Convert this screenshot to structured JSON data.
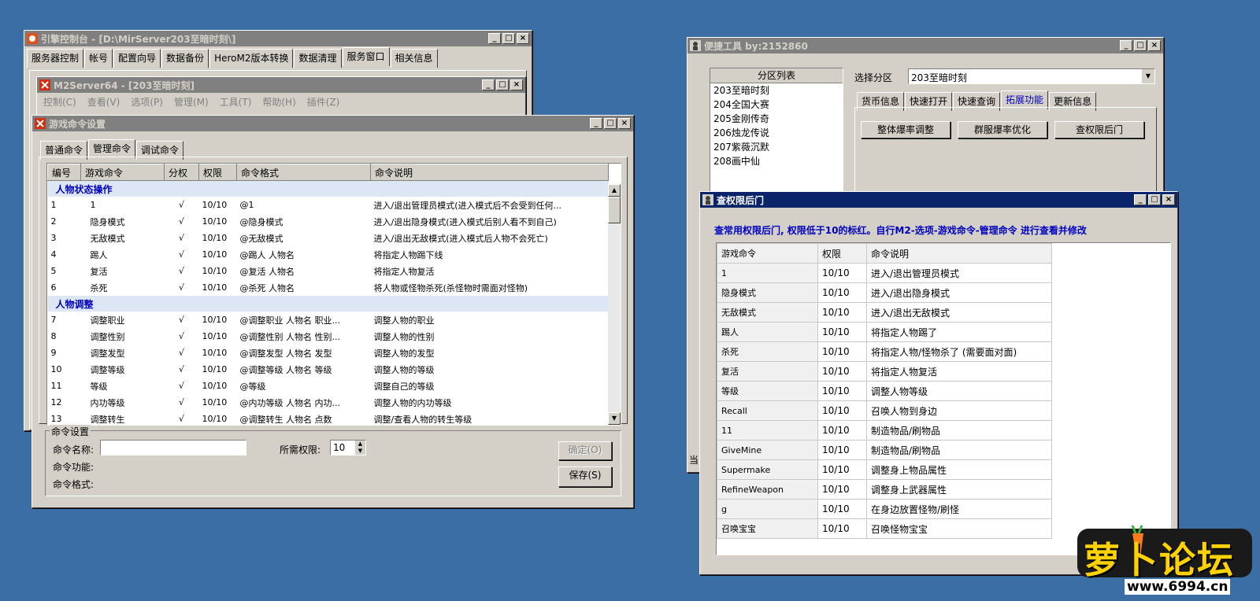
{
  "engine_console": {
    "title": "引擎控制台 - [D:\\MirServer203至暗时刻\\]",
    "tabs": [
      "服务器控制",
      "帐号",
      "配置向导",
      "数据备份",
      "HeroM2版本转换",
      "数据清理",
      "服务窗口",
      "相关信息"
    ],
    "selected_tab": "服务窗口"
  },
  "m2server": {
    "title": "M2Server64 - [203至暗时刻]",
    "menu": [
      "控制(C)",
      "查看(V)",
      "选项(P)",
      "管理(M)",
      "工具(T)",
      "帮助(H)",
      "插件(Z)"
    ]
  },
  "game_cmd": {
    "title": "游戏命令设置",
    "tabs": [
      "普通命令",
      "管理命令",
      "调试命令"
    ],
    "columns": [
      "编号",
      "游戏命令",
      "分权",
      "权限",
      "命令格式",
      "命令说明"
    ],
    "groups": [
      {
        "name": "人物状态操作",
        "rows": [
          [
            "1",
            "1",
            "√",
            "10/10",
            "@1",
            "进入/退出管理员模式(进入模式后不会受到任何..."
          ],
          [
            "2",
            "隐身模式",
            "√",
            "10/10",
            "@隐身模式",
            "进入/退出隐身模式(进入模式后别人看不到自己)"
          ],
          [
            "3",
            "无敌模式",
            "√",
            "10/10",
            "@无敌模式",
            "进入/退出无敌模式(进入模式后人物不会死亡)"
          ],
          [
            "4",
            "踢人",
            "√",
            "10/10",
            "@踢人 人物名",
            "将指定人物踢下线"
          ],
          [
            "5",
            "复活",
            "√",
            "10/10",
            "@复活 人物名",
            "将指定人物复活"
          ],
          [
            "6",
            "杀死",
            "√",
            "10/10",
            "@杀死 人物名",
            "将人物或怪物杀死(杀怪物时需面对怪物)"
          ]
        ]
      },
      {
        "name": "人物调整",
        "rows": [
          [
            "7",
            "调整职业",
            "√",
            "10/10",
            "@调整职业 人物名 职业...",
            "调整人物的职业"
          ],
          [
            "8",
            "调整性别",
            "√",
            "10/10",
            "@调整性别 人物名 性别...",
            "调整人物的性别"
          ],
          [
            "9",
            "调整发型",
            "√",
            "10/10",
            "@调整发型 人物名 发型",
            "调整人物的发型"
          ],
          [
            "10",
            "调整等级",
            "√",
            "10/10",
            "@调整等级 人物名 等级",
            "调整人物的等级"
          ],
          [
            "11",
            "等级",
            "√",
            "10/10",
            "@等级",
            "调整自己的等级"
          ],
          [
            "12",
            "内功等级",
            "√",
            "10/10",
            "@内功等级 人物名 内功...",
            "调整人物的内功等级"
          ],
          [
            "13",
            "调整转生",
            "√",
            "10/10",
            "@调整转生 人物名 点数",
            "调整/查看人物的转生等级"
          ]
        ]
      }
    ],
    "settings_legend": "命令设置",
    "cmd_name_label": "命令名称:",
    "cmd_name_value": "",
    "perm_label": "所需权限:",
    "perm_value": "10",
    "func_label": "命令功能:",
    "format_label": "命令格式:",
    "confirm_button": "确定(O)",
    "save_button": "保存(S)"
  },
  "quick_tool": {
    "title": "便捷工具   by:2152860",
    "partition_header": "分区列表",
    "partitions": [
      "203至暗时刻",
      "204全国大赛",
      "205金刚传奇",
      "206烛龙传说",
      "207紫薇沉默",
      "208画中仙"
    ],
    "select_label": "选择分区",
    "select_value": "203至暗时刻",
    "tabs": [
      "货币信息",
      "快速打开",
      "快速查询",
      "拓展功能",
      "更新信息"
    ],
    "selected_tab": "拓展功能",
    "buttons": [
      "整体爆率调整",
      "群服爆率优化",
      "查权限后门"
    ],
    "status_char": "当"
  },
  "perm_window": {
    "title": "查权限后门",
    "hint": "查常用权限后门, 权限低于10的标红。自行M2-选项-游戏命令-管理命令 进行查看并修改",
    "columns": [
      "游戏命令",
      "权限",
      "命令说明"
    ],
    "rows": [
      [
        "1",
        "10/10",
        "进入/退出管理员模式"
      ],
      [
        "隐身模式",
        "10/10",
        "进入/退出隐身模式"
      ],
      [
        "无敌模式",
        "10/10",
        "进入/退出无敌模式"
      ],
      [
        "踢人",
        "10/10",
        "将指定人物踢了"
      ],
      [
        "杀死",
        "10/10",
        "将指定人物/怪物杀了 (需要面对面)"
      ],
      [
        "复活",
        "10/10",
        "将指定人物复活"
      ],
      [
        "等级",
        "10/10",
        "调整人物等级"
      ],
      [
        "Recall",
        "10/10",
        "召唤人物到身边"
      ],
      [
        "11",
        "10/10",
        "制造物品/刷物品"
      ],
      [
        "GiveMine",
        "10/10",
        "制造物品/刷物品"
      ],
      [
        "Supermake",
        "10/10",
        "调整身上物品属性"
      ],
      [
        "RefineWeapon",
        "10/10",
        "调整身上武器属性"
      ],
      [
        "g",
        "10/10",
        "在身边放置怪物/刷怪"
      ],
      [
        "召唤宝宝",
        "10/10",
        "召唤怪物宝宝"
      ]
    ]
  },
  "watermark": {
    "text": "萝卜论坛",
    "url": "www.6994.cn"
  },
  "colors": {
    "desktop": "#3a6ea5",
    "title_active": "#0a246a",
    "title_inactive": "#808080",
    "group_text": "#0000c0",
    "hint_text": "#0000c0"
  }
}
